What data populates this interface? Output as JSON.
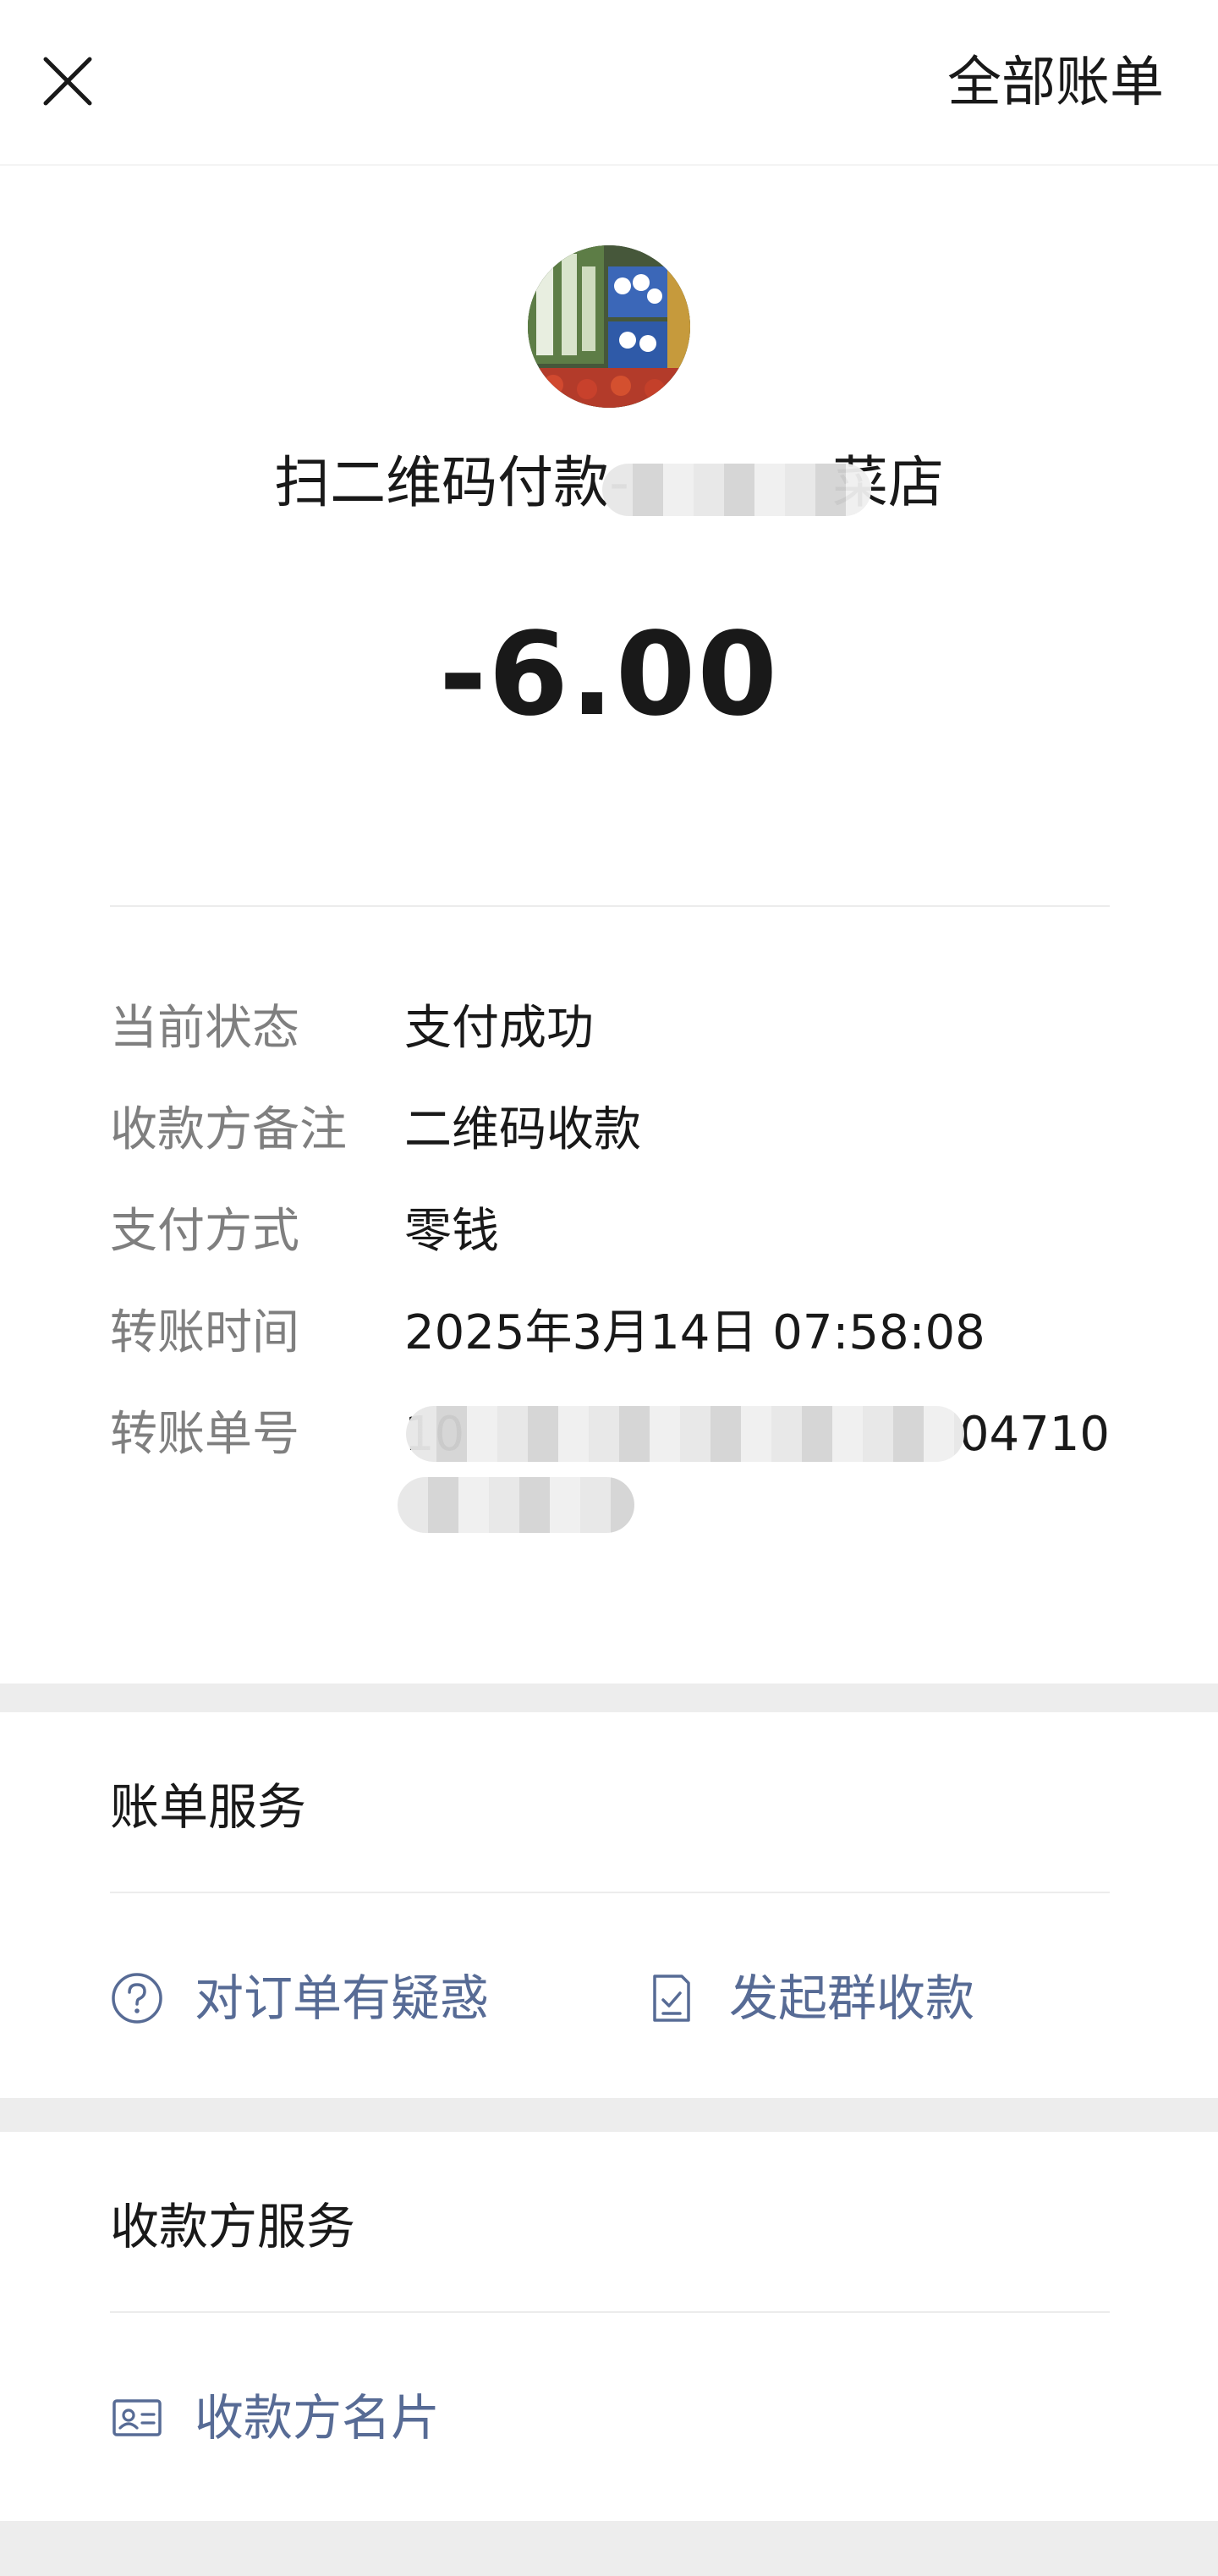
{
  "header": {
    "close_icon": "close-icon",
    "all_bills_label": "全部账单"
  },
  "payment": {
    "merchant_title_prefix": "扫二维码付款-",
    "merchant_title_suffix": "菜店",
    "amount": "-6.00",
    "avatar_icon": "merchant-avatar-vegetables"
  },
  "details": {
    "rows": [
      {
        "label": "当前状态",
        "value": "支付成功"
      },
      {
        "label": "收款方备注",
        "value": "二维码收款"
      },
      {
        "label": "支付方式",
        "value": "零钱"
      },
      {
        "label": "转账时间",
        "value": "2025年3月14日 07:58:08"
      },
      {
        "label": "转账单号",
        "value_visible_start": "10",
        "value_visible_end": "04710"
      }
    ]
  },
  "bill_service": {
    "title": "账单服务",
    "actions": [
      {
        "label": "对订单有疑惑",
        "icon": "question-circle-icon"
      },
      {
        "label": "发起群收款",
        "icon": "checklist-icon"
      }
    ]
  },
  "payee_service": {
    "title": "收款方服务",
    "actions": [
      {
        "label": "收款方名片",
        "icon": "business-card-icon"
      }
    ]
  },
  "colors": {
    "link": "#576b95",
    "label_gray": "#7f7f7f",
    "text": "#191919",
    "background": "#ededed"
  }
}
